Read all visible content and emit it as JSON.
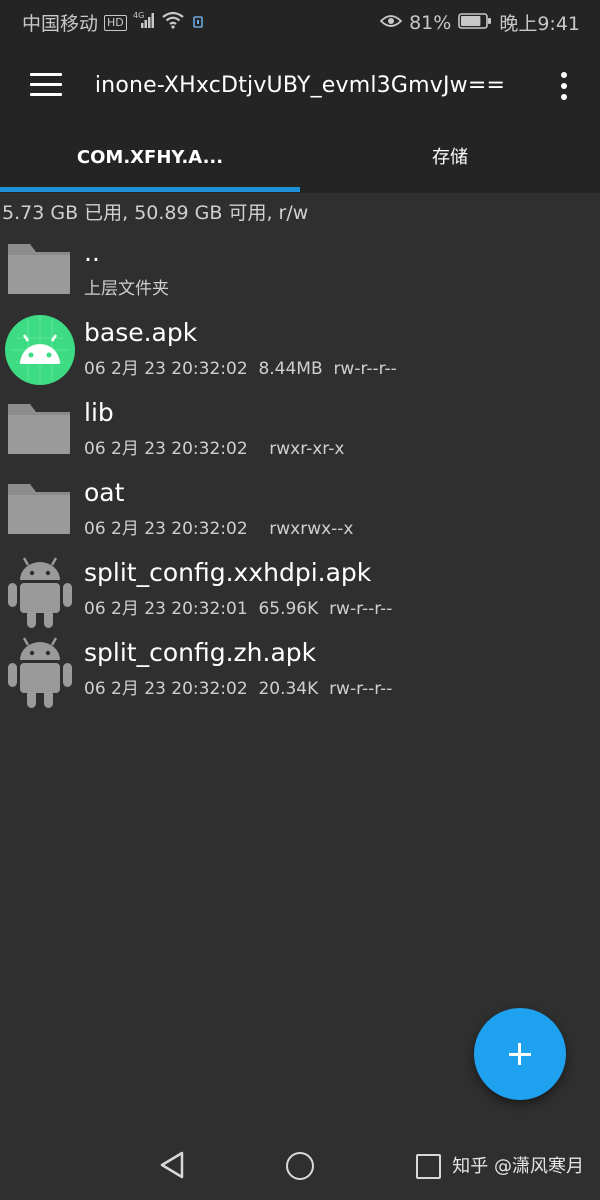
{
  "status_bar": {
    "carrier": "中国移动",
    "network_badge": "HD",
    "signal_label": "4G",
    "battery_percent": "81%",
    "battery_level": 0.81,
    "time": "晚上9:41"
  },
  "toolbar": {
    "title": "inone-XHxcDtjvUBY_evml3GmvJw=="
  },
  "tabs": [
    {
      "label": "COM.XFHY.A...",
      "selected": true
    },
    {
      "label": "存储",
      "selected": false
    }
  ],
  "storage_info": "5.73 GB 已用, 50.89 GB 可用, r/w",
  "files": [
    {
      "name": "..",
      "meta": "上层文件夹",
      "icon": "folder-icon"
    },
    {
      "name": "base.apk",
      "meta": "06 2月 23 20:32:02  8.44MB  rw-r--r--",
      "icon": "android-app-icon"
    },
    {
      "name": "lib",
      "meta": "06 2月 23 20:32:02    rwxr-xr-x",
      "icon": "folder-icon"
    },
    {
      "name": "oat",
      "meta": "06 2月 23 20:32:02    rwxrwx--x",
      "icon": "folder-icon"
    },
    {
      "name": "split_config.xxhdpi.apk",
      "meta": "06 2月 23 20:32:01  65.96K  rw-r--r--",
      "icon": "android-robot-icon"
    },
    {
      "name": "split_config.zh.apk",
      "meta": "06 2月 23 20:32:02  20.34K  rw-r--r--",
      "icon": "android-robot-icon"
    }
  ],
  "fab": {
    "icon": "plus-icon"
  },
  "watermark": "知乎 @潇风寒月",
  "colors": {
    "accent": "#1e90d8",
    "fab": "#1ea1ee",
    "background": "#2f2f2f",
    "toolbar": "#242424",
    "android_green": "#3ddc84"
  }
}
